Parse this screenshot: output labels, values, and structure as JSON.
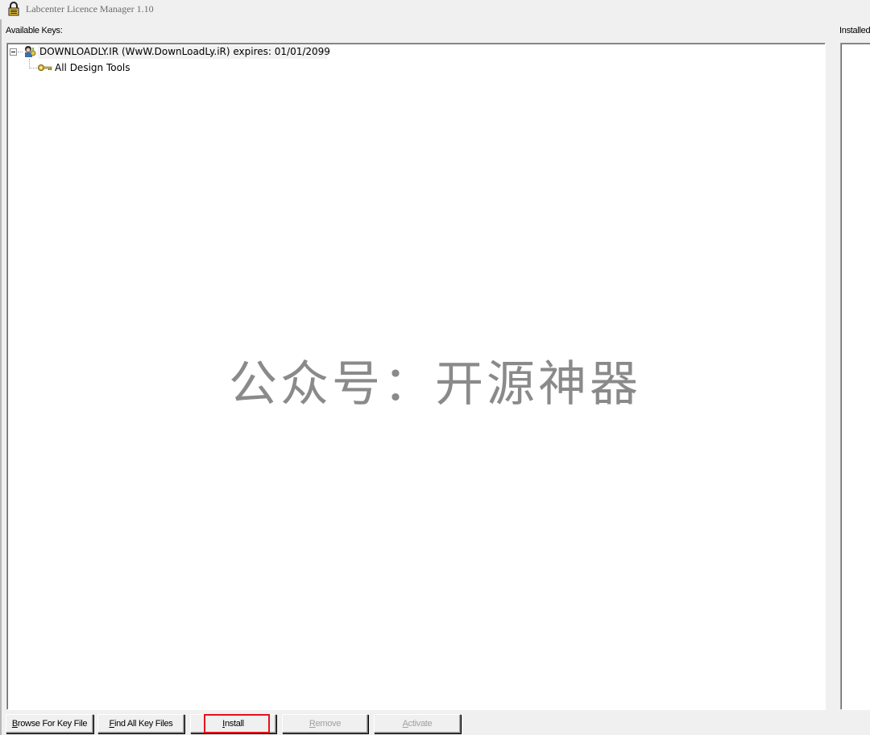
{
  "window": {
    "title": "Labcenter Licence Manager 1.10"
  },
  "available_keys": {
    "label": "Available Keys:",
    "tree": {
      "root": "DOWNLOADLY.IR (WwW.DownLoadLy.iR) expires: 01/01/2099",
      "children": [
        "All Design Tools"
      ]
    }
  },
  "installed_keys": {
    "label": "Installed"
  },
  "watermark": "公众号：开源神器",
  "buttons": {
    "browse": {
      "pre": "",
      "u": "B",
      "post": "rowse For Key File"
    },
    "find": {
      "pre": "",
      "u": "F",
      "post": "ind All Key Files"
    },
    "install": {
      "pre": "",
      "u": "I",
      "post": "nstall"
    },
    "remove": {
      "pre": "",
      "u": "R",
      "post": "emove"
    },
    "activate": {
      "pre": "",
      "u": "A",
      "post": "ctivate"
    }
  },
  "colors": {
    "highlight_border": "#e8101b"
  }
}
